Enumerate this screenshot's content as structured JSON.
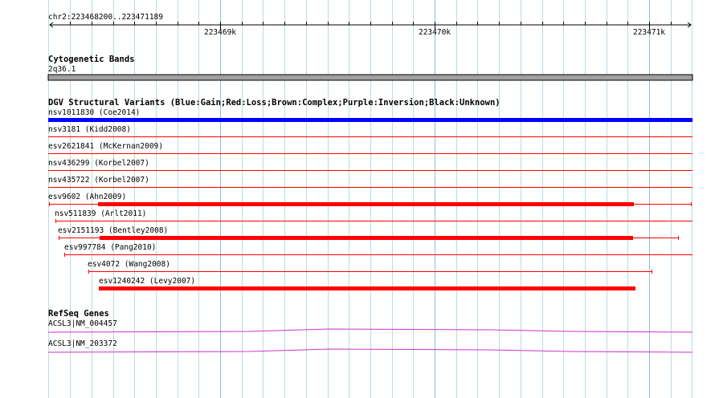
{
  "locus": "chr2:223468200..223471189",
  "ruler": {
    "ticks": [
      {
        "label": "223469k"
      },
      {
        "label": "223470k"
      },
      {
        "label": "223471k"
      }
    ]
  },
  "cytoband_track": {
    "title": "Cytogenetic Bands",
    "band_label": "2q36.1",
    "band_color": "#a0a0a0"
  },
  "dgv_track": {
    "title": "DGV Structural Variants (Blue:Gain;Red:Loss;Brown:Complex;Purple:Inversion;Black:Unknown)",
    "colors": {
      "gain": "#0000ff",
      "loss": "#ff0000"
    },
    "features": [
      {
        "label": "nsv1011830 (Coe2014)",
        "type": "gain"
      },
      {
        "label": "nsv3181 (Kidd2008)",
        "type": "loss"
      },
      {
        "label": "esv2621841 (McKernan2009)",
        "type": "loss"
      },
      {
        "label": "nsv436299 (Korbel2007)",
        "type": "loss"
      },
      {
        "label": "nsv435722 (Korbel2007)",
        "type": "loss"
      },
      {
        "label": "esv9602 (Ahn2009)",
        "type": "loss"
      },
      {
        "label": "nsv511839 (Arlt2011)",
        "type": "loss"
      },
      {
        "label": "esv2151193 (Bentley2008)",
        "type": "loss"
      },
      {
        "label": "esv997784 (Pang2010)",
        "type": "loss"
      },
      {
        "label": "esv4072 (Wang2008)",
        "type": "loss"
      },
      {
        "label": "esv1240242 (Levy2007)",
        "type": "loss"
      }
    ]
  },
  "refseq_track": {
    "title": "RefSeq Genes",
    "color": "#cc33cc",
    "genes": [
      {
        "label": "ACSL3|NM_004457"
      },
      {
        "label": "ACSL3|NM_203372"
      }
    ]
  }
}
